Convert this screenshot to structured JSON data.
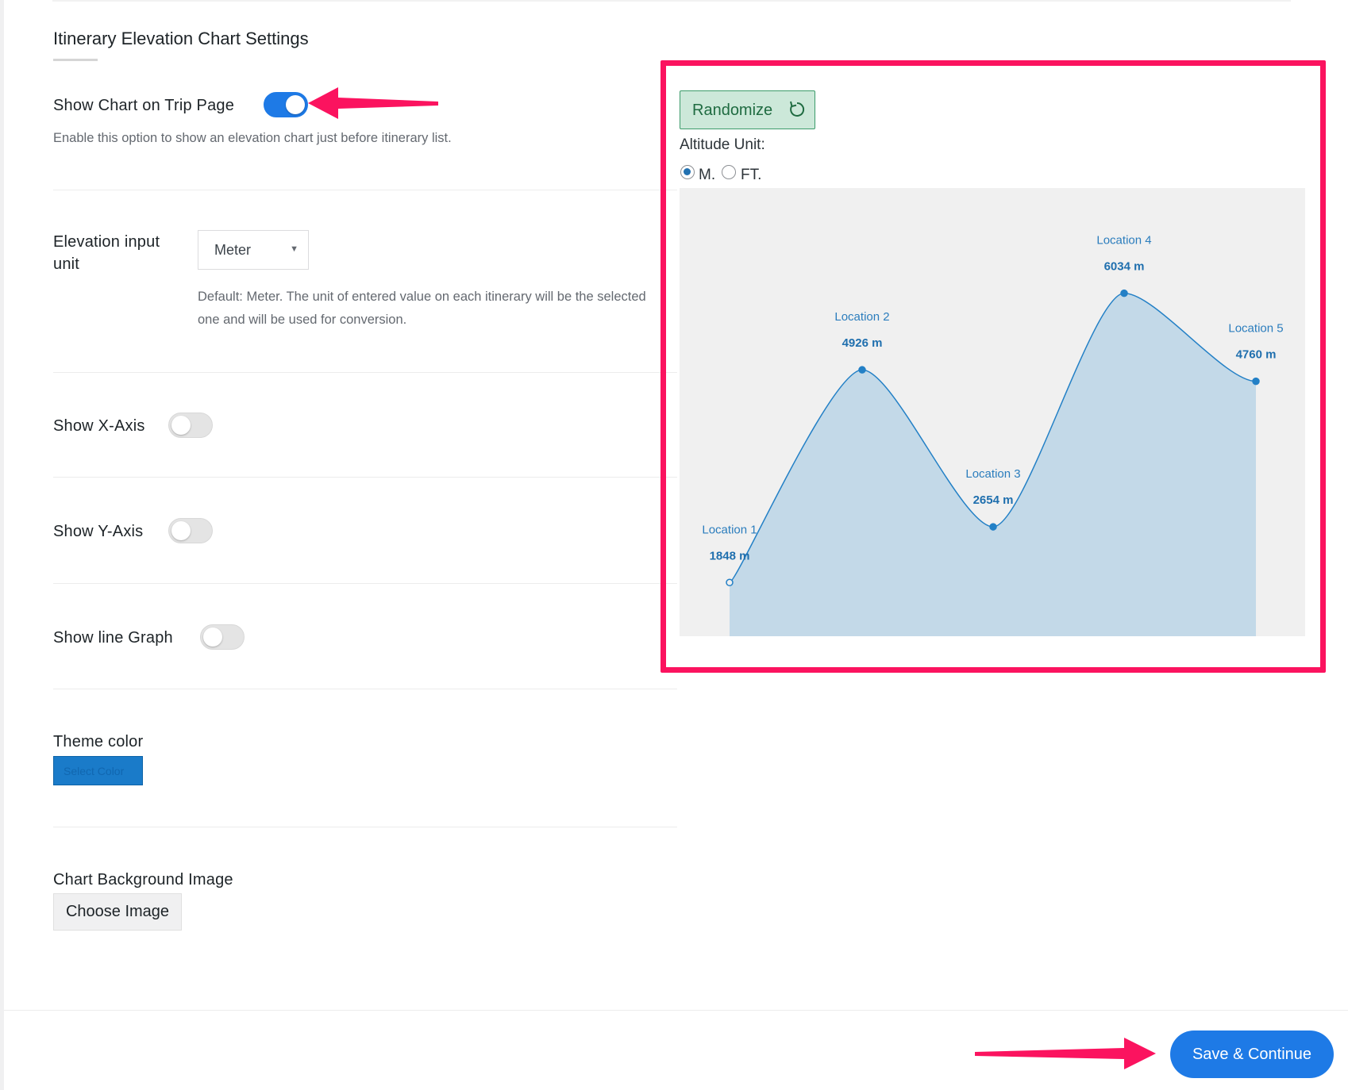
{
  "section": {
    "title": "Itinerary Elevation Chart Settings"
  },
  "show_chart": {
    "label": "Show Chart on Trip Page",
    "enabled": true,
    "description": "Enable this option to show an elevation chart just before itinerary list."
  },
  "elevation_unit": {
    "label_line1": "Elevation input",
    "label_line2": "unit",
    "selected": "Meter",
    "description_line1": "Default: Meter. The unit of entered value on each itinerary will be the selected",
    "description_line2": "one and will be used for conversion."
  },
  "show_x_axis": {
    "label": "Show X-Axis",
    "enabled": false
  },
  "show_y_axis": {
    "label": "Show Y-Axis",
    "enabled": false
  },
  "show_line_graph": {
    "label": "Show line Graph",
    "enabled": false
  },
  "theme_color": {
    "label": "Theme color",
    "button_text": "Select Color",
    "value": "#1a7bc9"
  },
  "background_image": {
    "label": "Chart Background Image",
    "button_label": "Choose Image"
  },
  "preview": {
    "randomize_label": "Randomize",
    "randomize_icon": "refresh-icon",
    "altitude_label": "Altitude Unit:",
    "unit_options": [
      {
        "label": "M.",
        "checked": true
      },
      {
        "label": "FT.",
        "checked": false
      }
    ]
  },
  "chart_data": {
    "type": "area",
    "categories": [
      "Location 1",
      "Location 2",
      "Location 3",
      "Location 4",
      "Location 5"
    ],
    "values": [
      1848,
      4926,
      2654,
      6034,
      4760
    ],
    "value_labels": [
      "1848 m",
      "4926 m",
      "2654 m",
      "6034 m",
      "4760 m"
    ],
    "unit": "m",
    "xlabel": "",
    "ylabel": "",
    "grid": false,
    "colors": {
      "line": "#2380c6",
      "fill": "#c3d9e8",
      "label": "#2b7dbd",
      "value": "#1f6fae",
      "background": "#f0f0f0"
    }
  },
  "footer": {
    "save_label": "Save & Continue"
  },
  "colors": {
    "accent": "#1e7ae6",
    "annotation": "#fb135f",
    "randomize_bg": "#cce8d9"
  },
  "annotations": [
    "arrow-icon",
    "arrow-icon"
  ]
}
